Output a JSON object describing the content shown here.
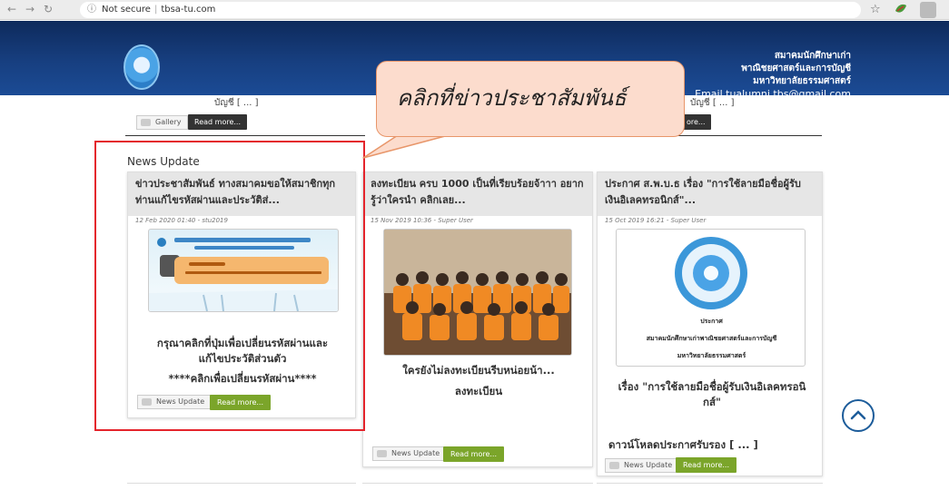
{
  "browser": {
    "security_label": "Not secure",
    "url": "tbsa-tu.com"
  },
  "header": {
    "org_line1": "สมาคมนักศึกษาเก่า",
    "org_line2": "พาณิชยศาสตร์และการบัญชี",
    "org_line3": "มหาวิทยาลัยธรรมศาสตร์",
    "email": "Email  tualumni.tbs@gmail.com"
  },
  "top_fragments": {
    "left_text": "บัญชี [ ... ]",
    "right_text": "บัญชี [ ... ]",
    "gallery_label": "Gallery",
    "read_more_left": "Read more...",
    "read_more_mid": "Read more...",
    "read_more_right_partial": "ore..."
  },
  "callout": {
    "text": "คลิกที่ข่าวประชาสัมพันธ์",
    "fill_color": "#fcdccd",
    "border_color": "#e8966a"
  },
  "news": {
    "section_title": "News Update",
    "highlight_color": "#e4242c",
    "cards": [
      {
        "title": "ข่าวประชาสัมพันธ์ ทางสมาคมขอให้สมาชิกทุกท่านแก้ไขรหัสผ่านและประวัติส่...",
        "meta": "12 Feb 2020 01:40 - stu2019",
        "body_line1": "กรุณาคลิกที่ปุ่มเพื่อเปลี่ยนรหัสผ่านและแก้ไขประวัติส่วนตัว",
        "body_line2": "****คลิกเพื่อเปลี่ยนรหัสผ่าน****",
        "category": "News Update",
        "read_more": "Read more..."
      },
      {
        "title": "ลงทะเบียน ครบ 1000 เป็นที่เรียบร้อยจ้าาา อยากรู้ว่าใครนำ คลิกเลย...",
        "meta": "15 Nov 2019 10:36 - Super User",
        "body_line1": "ใครยังไม่ลงทะเบียนรีบหน่อยน้า...",
        "body_line2": "ลงทะเบียน",
        "category": "News Update",
        "read_more": "Read more..."
      },
      {
        "title": "ประกาศ ส.พ.บ.ธ เรื่อง \"การใช้ลายมือชื่อผู้รับเงินอิเลคทรอนิกส์\"...",
        "meta": "15 Oct 2019 16:21 - Super User",
        "img_caption1": "ประกาศ",
        "img_caption2": "สมาคมนักศึกษาเก่าพาณิชยศาสตร์และการบัญชี",
        "img_caption3": "มหาวิทยาลัยธรรมศาสตร์",
        "body_line1": "เรื่อง \"การใช้ลายมือชื่อผู้รับเงินอิเลคทรอนิกส์\"",
        "body_line2": "ดาวน์โหลดประกาศรับรอง [ ... ]",
        "category": "News Update",
        "read_more": "Read more..."
      }
    ]
  },
  "colors": {
    "header_blue": "#173f80",
    "read_more_green": "#7ba52a",
    "scroll_up_blue": "#1c5c9a"
  }
}
